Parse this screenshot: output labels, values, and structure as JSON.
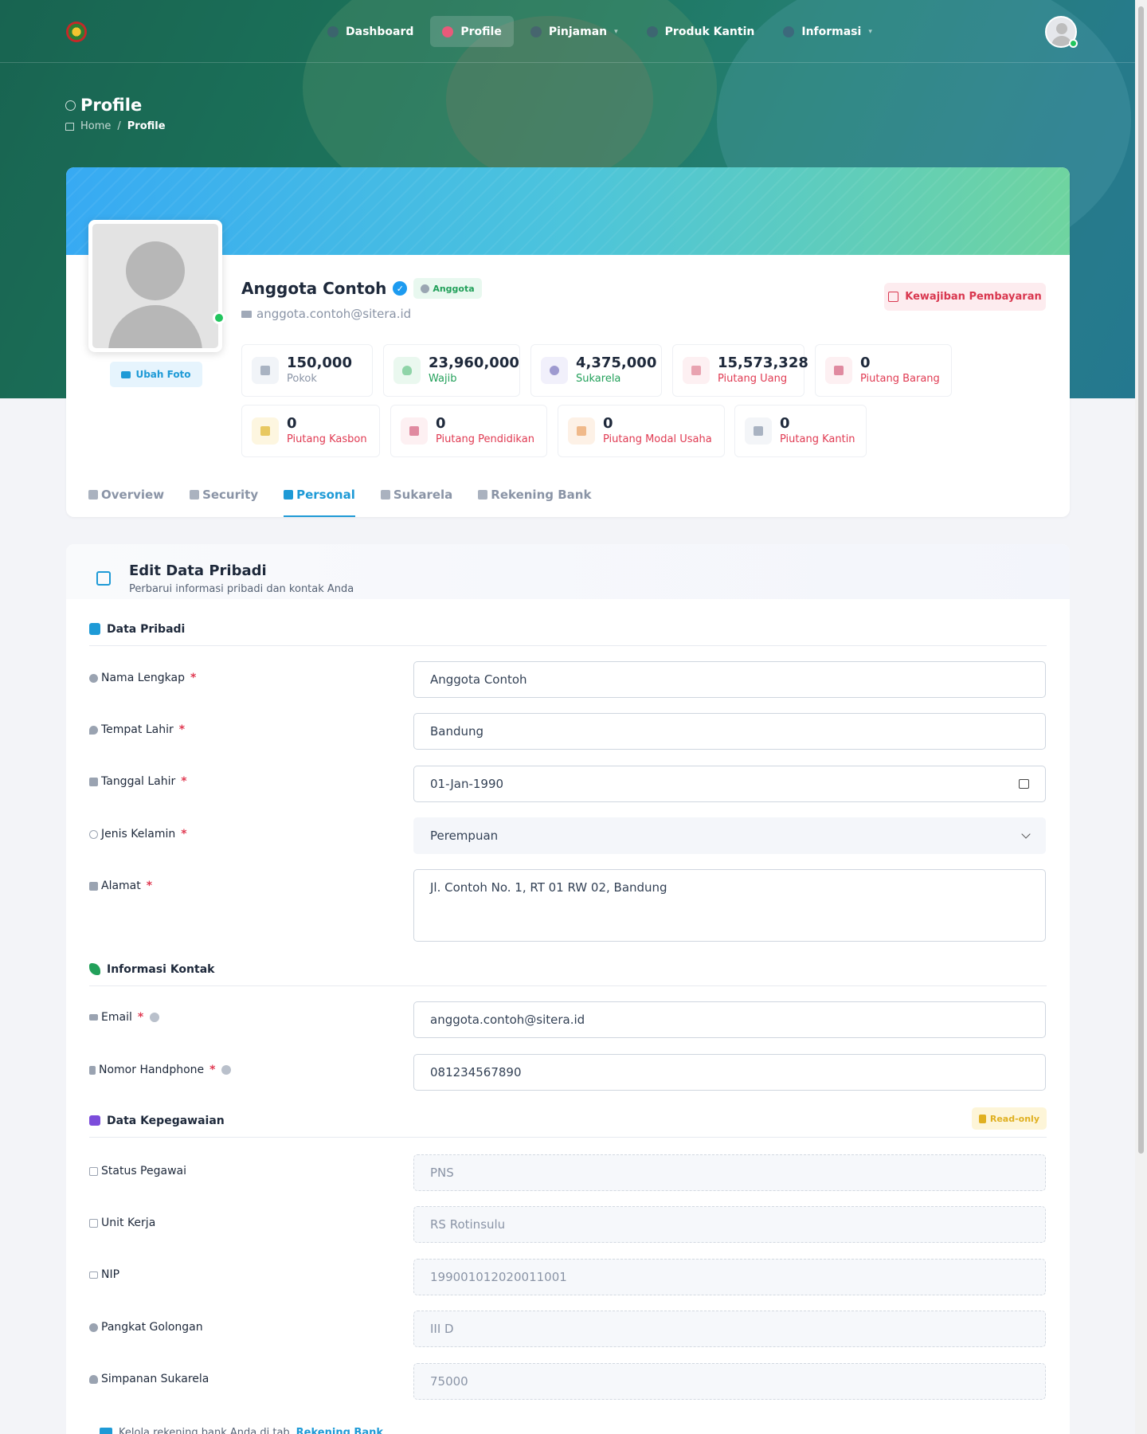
{
  "nav": {
    "items": [
      {
        "label": "Dashboard",
        "active": false,
        "dropdown": false
      },
      {
        "label": "Profile",
        "active": true,
        "dropdown": false
      },
      {
        "label": "Pinjaman",
        "active": false,
        "dropdown": true
      },
      {
        "label": "Produk Kantin",
        "active": false,
        "dropdown": false
      },
      {
        "label": "Informasi",
        "active": false,
        "dropdown": true
      }
    ]
  },
  "page": {
    "title": "Profile",
    "breadcrumb": {
      "home": "Home",
      "separator": "/",
      "current": "Profile"
    }
  },
  "profile": {
    "name": "Anggota Contoh",
    "role_badge": "Anggota",
    "email": "anggota.contoh@sitera.id",
    "change_photo_label": "Ubah Foto",
    "obligation_button": "Kewajiban Pembayaran",
    "stats": [
      {
        "value": "150,000",
        "label": "Pokok",
        "icon": "bank-icon"
      },
      {
        "value": "23,960,000",
        "label": "Wajib",
        "icon": "shield-icon"
      },
      {
        "value": "4,375,000",
        "label": "Sukarela",
        "icon": "piggy-bank-icon"
      },
      {
        "value": "15,573,328",
        "label": "Piutang Uang",
        "icon": "money-icon"
      },
      {
        "value": "0",
        "label": "Piutang Barang",
        "icon": "bag-icon"
      },
      {
        "value": "0",
        "label": "Piutang Kasbon",
        "icon": "envelope-icon"
      },
      {
        "value": "0",
        "label": "Piutang Pendidikan",
        "icon": "graduation-cap-icon"
      },
      {
        "value": "0",
        "label": "Piutang Modal Usaha",
        "icon": "store-icon"
      },
      {
        "value": "0",
        "label": "Piutang Kantin",
        "icon": "shop-icon"
      }
    ]
  },
  "tabs": [
    {
      "label": "Overview",
      "active": false
    },
    {
      "label": "Security",
      "active": false
    },
    {
      "label": "Personal",
      "active": true
    },
    {
      "label": "Sukarela",
      "active": false
    },
    {
      "label": "Rekening Bank",
      "active": false
    }
  ],
  "form": {
    "title": "Edit Data Pribadi",
    "subtitle": "Perbarui informasi pribadi dan kontak Anda",
    "sections": {
      "personal": "Data Pribadi",
      "contact": "Informasi Kontak",
      "employment": "Data Kepegawaian",
      "readonly_badge": "Read-only"
    },
    "required_mark": "*",
    "fields": {
      "full_name": {
        "label": "Nama Lengkap",
        "value": "Anggota Contoh"
      },
      "birth_place": {
        "label": "Tempat Lahir",
        "value": "Bandung"
      },
      "birth_date": {
        "label": "Tanggal Lahir",
        "value": "01-Jan-1990"
      },
      "gender": {
        "label": "Jenis Kelamin",
        "value": "Perempuan"
      },
      "address": {
        "label": "Alamat",
        "value": "Jl. Contoh No. 1, RT 01 RW 02, Bandung"
      },
      "email": {
        "label": "Email",
        "value": "anggota.contoh@sitera.id"
      },
      "phone": {
        "label": "Nomor Handphone",
        "value": "081234567890"
      },
      "employee_status": {
        "label": "Status Pegawai",
        "value": "PNS"
      },
      "work_unit": {
        "label": "Unit Kerja",
        "value": "RS Rotinsulu"
      },
      "nip": {
        "label": "NIP",
        "value": "199001012020011001"
      },
      "rank": {
        "label": "Pangkat Golongan",
        "value": "III D"
      },
      "voluntary_savings": {
        "label": "Simpanan Sukarela",
        "value": "75000"
      }
    },
    "bank_note": {
      "text": "Kelola rekening bank Anda di tab",
      "link": "Rekening Bank"
    }
  },
  "colors": {
    "accent": "#1e9ad6",
    "danger": "#e03a52",
    "success": "#22a05a",
    "warning": "#e0b020"
  }
}
